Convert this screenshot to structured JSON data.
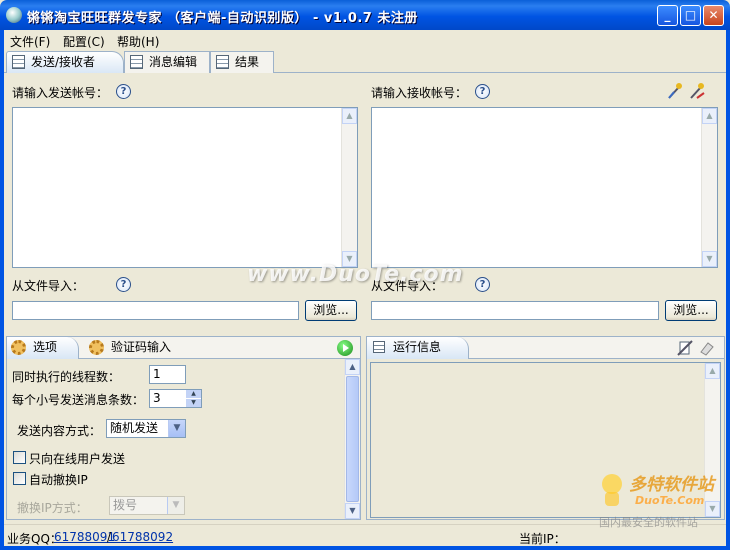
{
  "window": {
    "title": "锵锵淘宝旺旺群发专家 （客户端-自动识别版） - v1.0.7 未注册",
    "minimize": "_",
    "maximize": "□",
    "close": "✕"
  },
  "menu": [
    {
      "label": "文件(F)"
    },
    {
      "label": "配置(C)"
    },
    {
      "label": "帮助(H)"
    }
  ],
  "main_tabs": [
    {
      "label": "发送/接收者"
    },
    {
      "label": "消息编辑"
    },
    {
      "label": "结果"
    }
  ],
  "sender": {
    "label": "请输入发送帐号：",
    "help": "?",
    "import_label": "从文件导入：",
    "import_value": "",
    "browse": "浏览..."
  },
  "receiver": {
    "label": "请输入接收帐号：",
    "help": "?",
    "import_label": "从文件导入：",
    "import_value": "",
    "browse": "浏览..."
  },
  "watermark": "www.DuoTe.com",
  "options_panel": {
    "tabs": [
      {
        "label": "选项"
      },
      {
        "label": "验证码输入"
      }
    ],
    "threads_label": "同时执行的线程数：",
    "threads_value": "1",
    "per_account_label": "每个小号发送消息条数：",
    "per_account_value": "3",
    "content_mode_label": "发送内容方式：",
    "content_mode_value": "随机发送",
    "online_only_label": "只向在线用户发送",
    "auto_ip_label": "自动撤换IP",
    "ip_mode_label": "撤换IP方式：",
    "ip_mode_value": "拨号"
  },
  "log_panel": {
    "tab_label": "运行信息"
  },
  "status": {
    "qq_label": "业务QQ：",
    "qq1": "61788091",
    "separator": "/",
    "qq2": "61788092",
    "ip_label": "当前IP："
  },
  "logo_watermark": {
    "brand": "多特软件站",
    "site": "DuoTe.Com",
    "slogan": "国内最安全的软件站"
  }
}
